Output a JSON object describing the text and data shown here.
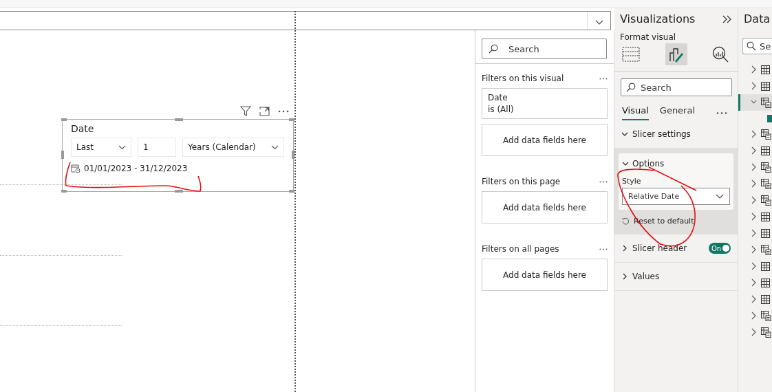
{
  "slicer": {
    "title": "Date",
    "mode": "Last",
    "count": "1",
    "unit": "Years (Calendar)",
    "range": "01/01/2023 - 31/12/2023"
  },
  "filters": {
    "search_placeholder": "Search",
    "sections": [
      {
        "title": "Filters on this visual",
        "cards": [
          {
            "field": "Date",
            "condition": "is (All)"
          }
        ],
        "drop": "Add data fields here"
      },
      {
        "title": "Filters on this page",
        "drop": "Add data fields here"
      },
      {
        "title": "Filters on all pages",
        "drop": "Add data fields here"
      }
    ]
  },
  "visualizations": {
    "title": "Visualizations",
    "subtitle": "Format visual",
    "modes": [
      {
        "kind": "build",
        "selected": false
      },
      {
        "kind": "format",
        "selected": true
      },
      {
        "kind": "analytics",
        "selected": false
      }
    ],
    "search_placeholder": "Search",
    "tabs": [
      {
        "label": "Visual",
        "selected": true
      },
      {
        "label": "General",
        "selected": false
      }
    ],
    "sections": [
      {
        "label": "Slicer settings",
        "expanded": true,
        "kind": "group",
        "options": {
          "label": "Options",
          "expanded": true,
          "style_label": "Style",
          "style_value": "Relative Date",
          "reset": "Reset to default"
        }
      },
      {
        "label": "Slicer header",
        "expanded": false,
        "kind": "toggle",
        "toggle": {
          "on": true,
          "label": "On"
        }
      },
      {
        "label": "Values",
        "expanded": false,
        "kind": "plain"
      }
    ]
  },
  "data": {
    "title": "Data",
    "search_placeholder": "Se",
    "tables": [
      {
        "kind": "table",
        "expanded": false,
        "selected": false
      },
      {
        "kind": "table",
        "expanded": false,
        "selected": false
      },
      {
        "kind": "calculated",
        "expanded": true,
        "selected": true,
        "children": [
          {
            "checked": true
          }
        ]
      },
      {
        "kind": "calculated",
        "expanded": false,
        "selected": false
      },
      {
        "kind": "table",
        "expanded": false,
        "selected": false
      },
      {
        "kind": "calculated",
        "expanded": false,
        "selected": false
      },
      {
        "kind": "calculated",
        "expanded": false,
        "selected": false
      },
      {
        "kind": "calculated",
        "expanded": false,
        "selected": false
      },
      {
        "kind": "table",
        "expanded": false,
        "selected": false
      },
      {
        "kind": "table",
        "expanded": false,
        "selected": false
      },
      {
        "kind": "calculated",
        "expanded": false,
        "selected": false
      },
      {
        "kind": "table",
        "expanded": false,
        "selected": false
      },
      {
        "kind": "table",
        "expanded": false,
        "selected": false
      },
      {
        "kind": "table",
        "expanded": false,
        "selected": false
      },
      {
        "kind": "calculated",
        "expanded": false,
        "selected": false
      },
      {
        "kind": "calculated",
        "expanded": false,
        "selected": false
      }
    ]
  },
  "annotations": {
    "range_underlined": true,
    "options_circled": true
  }
}
